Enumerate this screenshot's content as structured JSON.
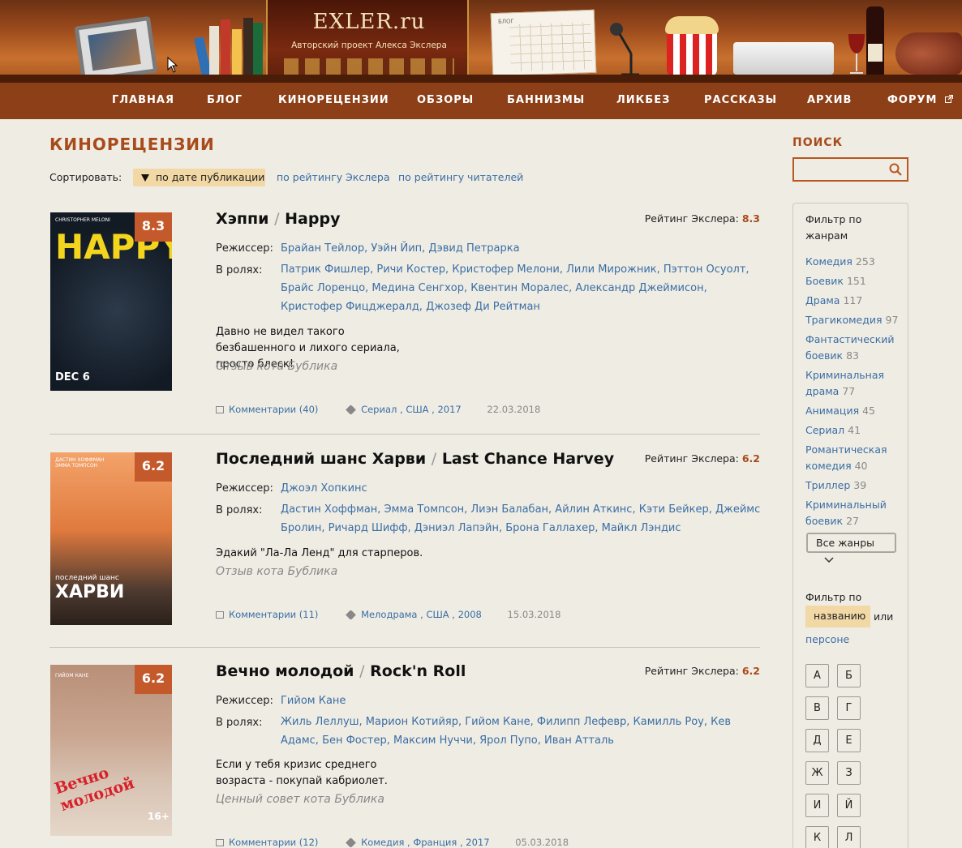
{
  "header": {
    "logo_text": "EXLER.ru",
    "tagline": "Авторский проект Алекса Экслера",
    "calendar_label": "БЛОГ"
  },
  "nav": {
    "items": [
      "ГЛАВНАЯ",
      "БЛОГ",
      "КИНОРЕЦЕНЗИИ",
      "ОБЗОРЫ",
      "БАННИЗМЫ",
      "ЛИКБЕЗ",
      "РАССКАЗЫ",
      "АРХИВ",
      "ФОРУМ"
    ]
  },
  "page": {
    "title": "КИНОРЕЦЕНЗИИ",
    "sort_label": "Сортировать:",
    "sort_options": [
      "по дате публикации",
      "по рейтингу Экслера",
      "по рейтингу читателей"
    ],
    "active_sort": "по дате публикации"
  },
  "labels": {
    "rating_prefix": "Рейтинг Экслера: ",
    "director": "Режиссер:",
    "cast": "В ролях:",
    "comments": "Комментарии"
  },
  "reviews": [
    {
      "title_ru": "Хэппи",
      "title_en": "Happy",
      "rating": "8.3",
      "director": "Брайан Тейлор, Уэйн Йип, Дэвид Петрарка",
      "cast": "Патрик Фишлер, Ричи Костер, Кристофер Мелони, Лили Мирожник, Пэттон Осуолт, Брайс Лоренцо, Медина Сенгхор, Квентин Моралес, Александр Джеймисон, Кристофер Фицджералд, Джозеф Ди Рейтман",
      "quote": "Давно не видел такого безбашенного и лихого сериала, просто блеск!",
      "signature": "Отзыв кота Бублика",
      "comments": "Комментарии (40)",
      "genre": "Сериал",
      "country": "США",
      "year": "2017",
      "date": "22.03.2018",
      "poster_top": "CHRISTOPHER MELONI",
      "poster_main": "HAPPY!",
      "poster_extra": "DEC 6"
    },
    {
      "title_ru": "Последний шанс Харви",
      "title_en": "Last Chance Harvey",
      "rating": "6.2",
      "director": "Джоэл Хопкинс",
      "cast": "Дастин Хоффман, Эмма Томпсон, Лиэн Балабан, Айлин Аткинс, Кэти Бейкер, Джеймс Бролин, Ричард Шифф, Дэниэл Лапэйн, Брона Галлахер, Майкл Лэндис",
      "quote": "Эдакий \"Ла-Ла Ленд\" для старперов.",
      "signature": "Отзыв кота Бублика",
      "comments": "Комментарии (11)",
      "genre": "Мелодрама",
      "country": "США",
      "year": "2008",
      "date": "15.03.2018",
      "poster_top": "ДАСТИН ХОФФМАН  ЭММА ТОМПСОН",
      "poster_main": "ХАРВИ",
      "poster_sub": "последний шанс"
    },
    {
      "title_ru": "Вечно молодой",
      "title_en": "Rock'n Roll",
      "rating": "6.2",
      "director": "Гийом Кане",
      "cast": "Жиль Леллуш, Марион Котийяр, Гийом Кане, Филипп Лефевр, Камилль Роу, Кев Адамс, Бен Фостер, Максим Нуччи, Ярол Пупо, Иван Атталь",
      "quote": "Если у тебя кризис среднего возраста - покупай кабриолет.",
      "signature": "Ценный совет кота Бублика",
      "comments": "Комментарии (12)",
      "genre": "Комедия",
      "country": "Франция",
      "year": "2017",
      "date": "05.03.2018",
      "poster_top": "ГИЙОМ КАНЕ",
      "poster_main": "Вечно молодой",
      "poster_extra": "16+"
    }
  ],
  "sidebar": {
    "search_title": "ПОИСК",
    "search_value": "",
    "genre_filter_title": "Фильтр по жанрам",
    "genres": [
      {
        "name": "Комедия",
        "count": "253"
      },
      {
        "name": "Боевик",
        "count": "151"
      },
      {
        "name": "Драма",
        "count": "117"
      },
      {
        "name": "Трагикомедия",
        "count": "97"
      },
      {
        "name": "Фантастический боевик",
        "count": "83"
      },
      {
        "name": "Криминальная драма",
        "count": "77"
      },
      {
        "name": "Анимация",
        "count": "45"
      },
      {
        "name": "Сериал",
        "count": "41"
      },
      {
        "name": "Романтическая комедия",
        "count": "40"
      },
      {
        "name": "Триллер",
        "count": "39"
      },
      {
        "name": "Криминальный боевик",
        "count": "27"
      }
    ],
    "all_genres": "Все жанры",
    "name_filter_title": "Фильтр по",
    "name_option": "названию",
    "or_text": "или",
    "persons_option": "персоне",
    "letters": [
      "А",
      "Б",
      "В",
      "Г",
      "Д",
      "Е",
      "Ж",
      "З",
      "И",
      "Й",
      "К",
      "Л"
    ]
  },
  "colors": {
    "accent": "#a84b1c",
    "nav_bg": "#8d3f17",
    "link": "#3a6ea5",
    "highlight": "#f1d8a5",
    "badge": "#c4592b"
  }
}
